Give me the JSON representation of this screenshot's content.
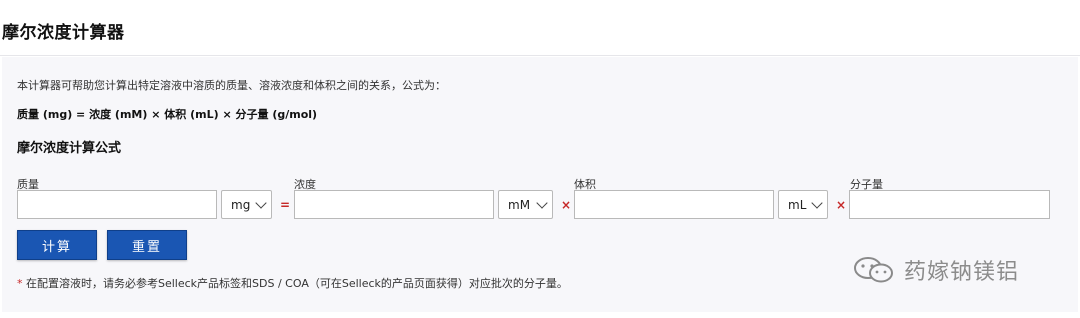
{
  "header": {
    "title": "摩尔浓度计算器"
  },
  "intro": {
    "description": "本计算器可帮助您计算出特定溶液中溶质的质量、溶液浓度和体积之间的关系，公式为：",
    "formula": "质量 (mg) = 浓度 (mM) × 体积 (mL) × 分子量 (g/mol)",
    "section_title": "摩尔浓度计算公式"
  },
  "form": {
    "mass": {
      "label": "质量",
      "value": "",
      "unit": "mg"
    },
    "equals": "=",
    "concentration": {
      "label": "浓度",
      "value": "",
      "unit": "mM"
    },
    "times1": "×",
    "volume": {
      "label": "体积",
      "value": "",
      "unit": "mL"
    },
    "times2": "×",
    "molecular_weight": {
      "label": "分子量",
      "value": ""
    }
  },
  "buttons": {
    "calculate": "计算",
    "reset": "重置"
  },
  "note": {
    "star": "*",
    "text": " 在配置溶液时，请务必参考Selleck产品标签和SDS / COA（可在Selleck的产品页面获得）对应批次的分子量。"
  },
  "watermark": {
    "text": "药嫁钠镁铝",
    "icon": "wechat-icon"
  },
  "colors": {
    "button_bg": "#1a56b3",
    "operator": "#c62828",
    "panel_bg": "#f7f7fa"
  }
}
